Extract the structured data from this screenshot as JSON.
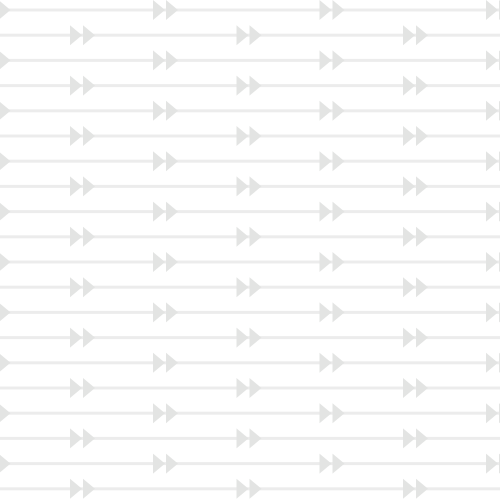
{
  "pattern": {
    "name": "repeating-arrow-lines",
    "background_color": "#ffffff",
    "line_color": "#ececec",
    "arrow_color": "#e3e4e3",
    "line_count": 20,
    "arrows_per_row": 3,
    "icon": "double-chevron-right-icon"
  }
}
